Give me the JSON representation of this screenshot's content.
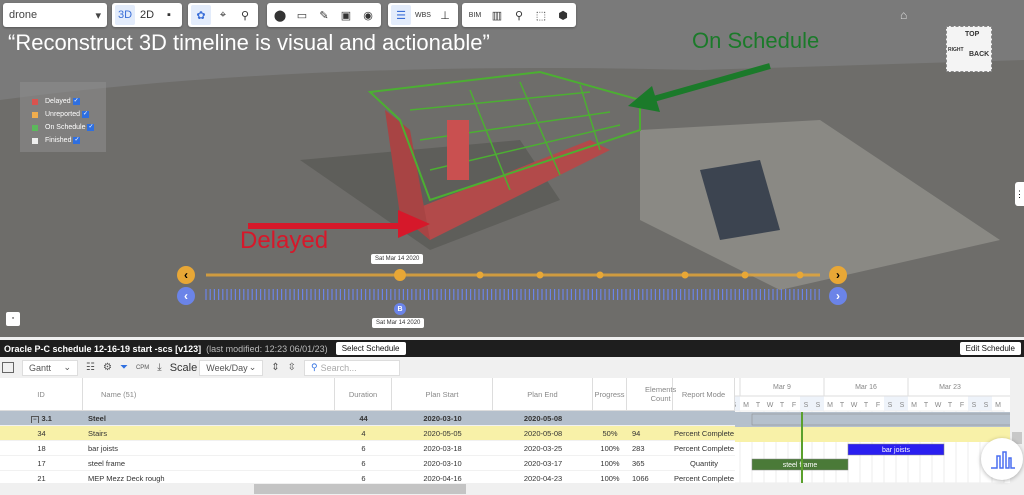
{
  "toolbar3d": {
    "model_select": "drone",
    "view_3d": "3D",
    "view_2d": "2D",
    "wbs": "WBS",
    "bim": "BIM"
  },
  "annotations": {
    "headline": "“Reconstruct 3D timeline is visual and actionable”",
    "on_schedule": "On Schedule",
    "delayed": "Delayed"
  },
  "legend": [
    {
      "label": "Delayed",
      "color": "#d9534f",
      "checked": true
    },
    {
      "label": "Unreported",
      "color": "#f0ad4e",
      "checked": true
    },
    {
      "label": "On Schedule",
      "color": "#5cb85c",
      "checked": true
    },
    {
      "label": "Finished",
      "color": "#eeeeee",
      "checked": true
    }
  ],
  "timeline": {
    "top_date": "Sat Mar 14 2020",
    "bottom_date": "Sat Mar 14 2020",
    "marker": "B",
    "prev": "‹",
    "next": "›"
  },
  "navcube": {
    "top": "TOP",
    "right": "RIGHT",
    "back": "BACK"
  },
  "schedule": {
    "title": "Oracle P-C schedule 12-16-19 start -scs [v123]",
    "modified": "(last modified: 12:23 06/01/23)",
    "select_button": "Select Schedule",
    "edit_button": "Edit Schedule"
  },
  "sched_toolbar": {
    "view": "Gantt",
    "scale_label": "Scale",
    "scale": "Week/Day",
    "search_placeholder": "Search...",
    "cpm": "CPM"
  },
  "columns": [
    "ID",
    "Name (51)",
    "Duration",
    "Plan Start",
    "Plan End",
    "Progress",
    "Elements Count",
    "Report Mode"
  ],
  "rows": [
    {
      "id": "3.1",
      "name": "Steel",
      "duration": "44",
      "start": "2020-03-10",
      "end": "2020-05-08",
      "progress": "",
      "count": "",
      "mode": ""
    },
    {
      "id": "34",
      "name": "Stairs",
      "duration": "4",
      "start": "2020-05-05",
      "end": "2020-05-08",
      "progress": "50%",
      "count": "94",
      "mode": "Percent Complete"
    },
    {
      "id": "18",
      "name": "bar joists",
      "duration": "6",
      "start": "2020-03-18",
      "end": "2020-03-25",
      "progress": "100%",
      "count": "283",
      "mode": "Percent Complete"
    },
    {
      "id": "17",
      "name": "steel frame",
      "duration": "6",
      "start": "2020-03-10",
      "end": "2020-03-17",
      "progress": "100%",
      "count": "365",
      "mode": "Quantity"
    },
    {
      "id": "21",
      "name": "MEP Mezz Deck rough",
      "duration": "6",
      "start": "2020-04-16",
      "end": "2020-04-23",
      "progress": "100%",
      "count": "1066",
      "mode": "Percent Complete"
    }
  ],
  "gantt": {
    "weeks": [
      "Mar 9",
      "Mar 16",
      "Mar 23"
    ],
    "days": [
      "S",
      "M",
      "T",
      "W",
      "T",
      "F",
      "S",
      "S",
      "M",
      "T",
      "W",
      "T",
      "F",
      "S",
      "S",
      "M",
      "T",
      "W",
      "T",
      "F",
      "S",
      "S",
      "M"
    ],
    "first_day": "2020-03-08",
    "today": "2020-03-14",
    "bars": [
      {
        "label": "",
        "start": "2020-03-10",
        "end": "2020-05-08",
        "color": "#b5c0cc",
        "row": 0
      },
      {
        "label": "bar joists",
        "start": "2020-03-18",
        "end": "2020-03-25",
        "color": "#2a1ff0",
        "row": 2
      },
      {
        "label": "steel frame",
        "start": "2020-03-10",
        "end": "2020-03-17",
        "color": "#4a7a38",
        "row": 3
      }
    ],
    "today_color": "#5aa02c"
  }
}
